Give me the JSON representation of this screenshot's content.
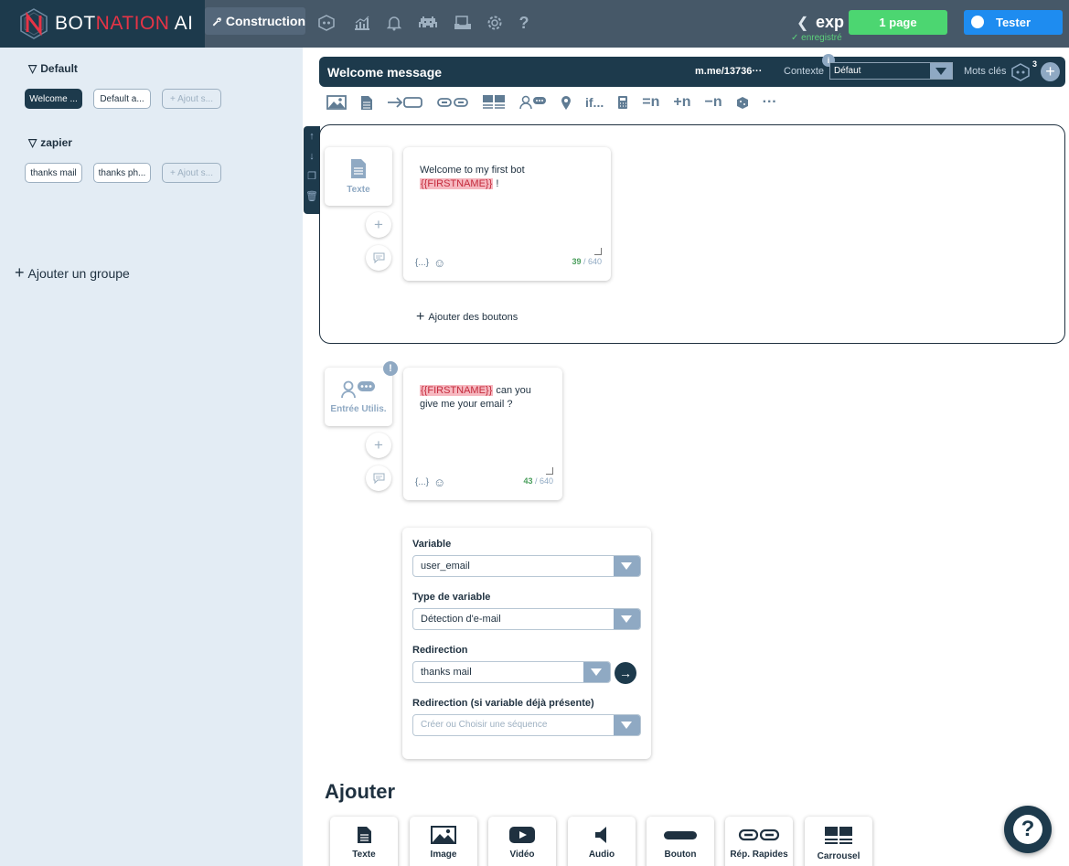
{
  "brand": {
    "logo_text_a": "BOT",
    "logo_text_b": "NATION",
    "logo_text_c": " AI"
  },
  "nav": {
    "construction_label": "Construction",
    "bot_name": "exp",
    "saved_status": "✓ enregistré",
    "pages_label": "1 page",
    "test_label": "Tester",
    "icons": [
      "bot-icon",
      "stats-icon",
      "bell-icon",
      "invader-icon",
      "inbox-icon",
      "gear-icon",
      "help-icon"
    ]
  },
  "sidebar": {
    "groups": [
      {
        "name": "Default",
        "sequences": [
          "Welcome ...",
          "Default a..."
        ],
        "add_label": "+ Ajout s..."
      },
      {
        "name": "zapier",
        "sequences": [
          "thanks mail",
          "thanks ph..."
        ],
        "add_label": "+ Ajout s..."
      }
    ],
    "add_group_label": "Ajouter un groupe"
  },
  "sequence": {
    "title": "Welcome message",
    "link": "m.me/13736···",
    "context_label": "Contexte",
    "context_info": "i",
    "context_value": "Défaut",
    "keywords_label": "Mots clés",
    "keywords_count": "3"
  },
  "toolbar": {
    "items": [
      "image-tool-icon",
      "text-tool-icon",
      "redirect-tool-icon",
      "quick-replies-tool-icon",
      "carousel-tool-icon",
      "user-input-tool-icon",
      "location-tool-icon",
      "if...",
      "calculator-tool-icon",
      "=n",
      "+n",
      "−n",
      "random-tool-icon",
      "···"
    ]
  },
  "blocks": [
    {
      "type_label": "Texte",
      "text_before": "Welcome to my first bot",
      "variable": "{{FIRSTNAME}}",
      "text_after": " !",
      "vars_button": "{...}",
      "count_used": "39",
      "count_max": " / 640",
      "add_buttons_label": "Ajouter des boutons"
    },
    {
      "type_label": "Entrée Utilis.",
      "warning": "!",
      "variable": "{{FIRSTNAME}}",
      "text_after": " can you give me your email ?",
      "vars_button": "{...}",
      "count_used": "43",
      "count_max": " / 640"
    }
  ],
  "variable_panel": {
    "variable_label": "Variable",
    "variable_value": "user_email",
    "type_label": "Type de variable",
    "type_value": "Détection d'e-mail",
    "redirect_label": "Redirection",
    "redirect_value": "thanks mail",
    "redirect_present_label": "Redirection (si variable déjà présente)",
    "redirect_present_placeholder": "Créer ou Choisir une séquence"
  },
  "add_section": {
    "title": "Ajouter",
    "items": [
      "Texte",
      "Image",
      "Vidéo",
      "Audio",
      "Bouton",
      "Rép. Rapides",
      "Carrousel"
    ]
  },
  "colors": {
    "primary": "#1d3a4c",
    "accent_green": "#4cd671",
    "accent_blue": "#1e8cf0",
    "variable_pink": "#f6b8c0"
  }
}
